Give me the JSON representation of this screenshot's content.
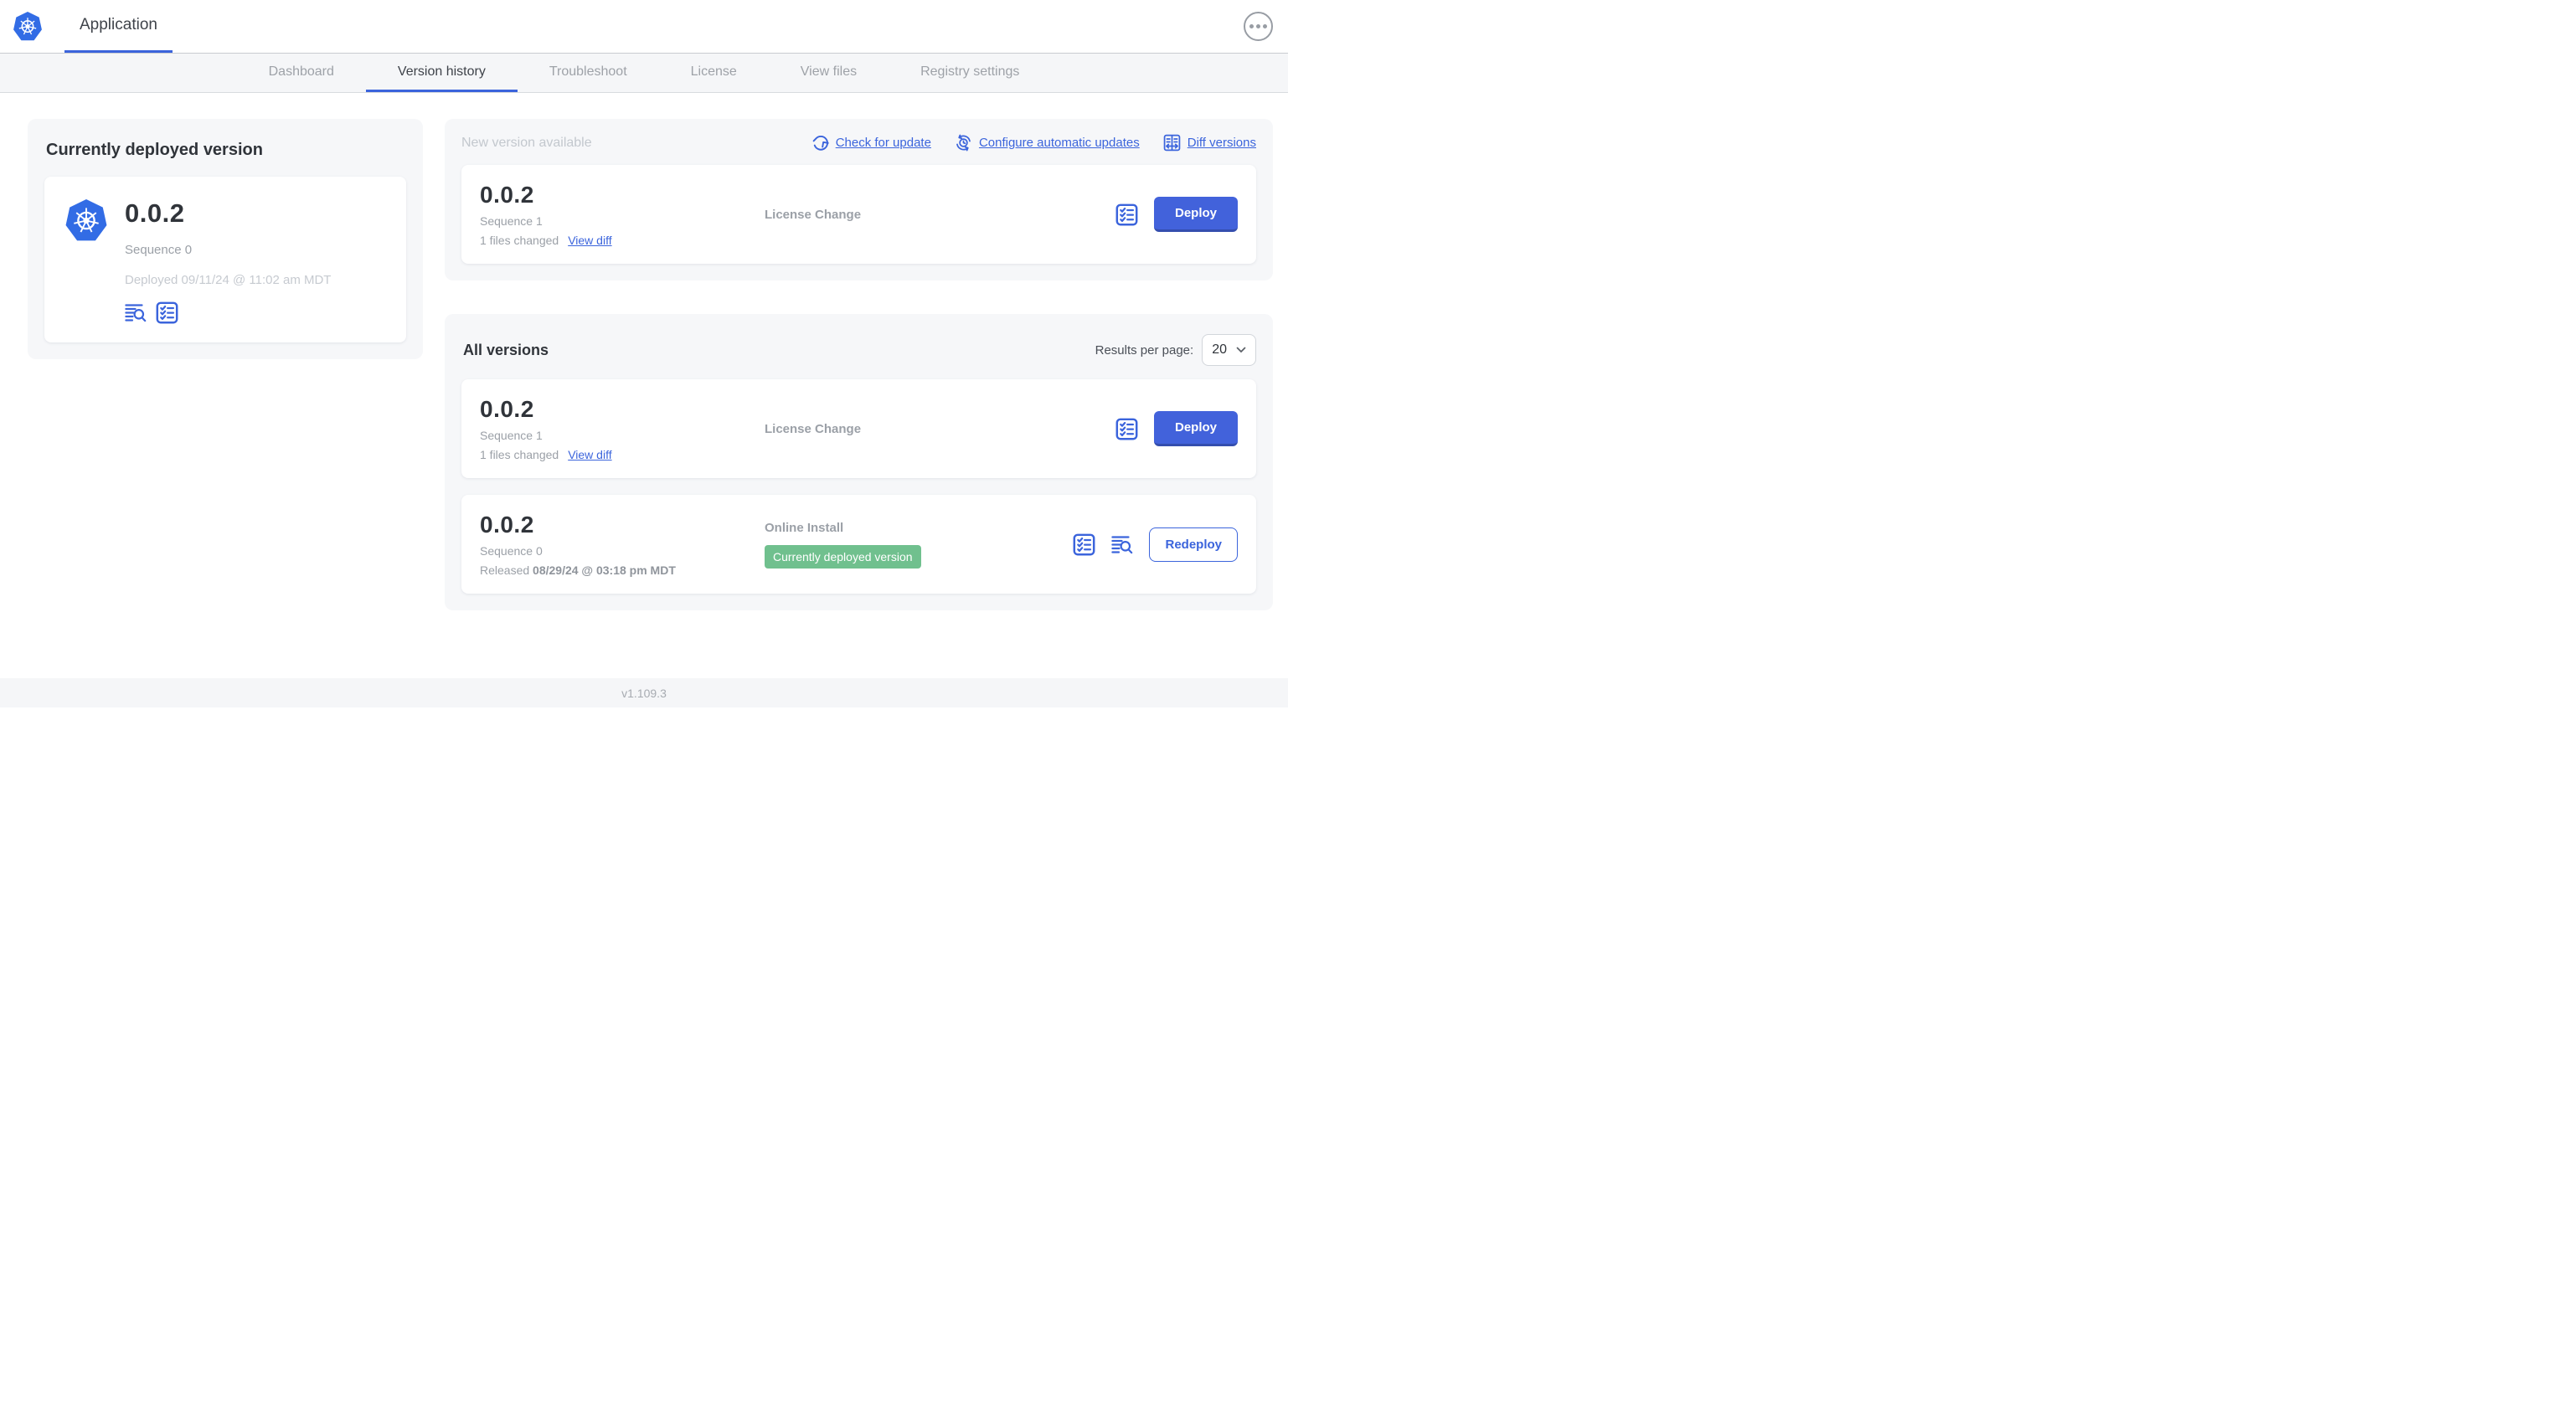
{
  "colors": {
    "accent_blue": "#3b64dc",
    "button_blue": "#4262db",
    "kubernetes_blue": "#326ce5",
    "badge_green": "#70c08e",
    "panel_gray": "#f6f7f9"
  },
  "header": {
    "app_tab_label": "Application"
  },
  "nav_tabs": [
    {
      "label": "Dashboard",
      "active": false
    },
    {
      "label": "Version history",
      "active": true
    },
    {
      "label": "Troubleshoot",
      "active": false
    },
    {
      "label": "License",
      "active": false
    },
    {
      "label": "View files",
      "active": false
    },
    {
      "label": "Registry settings",
      "active": false
    }
  ],
  "current_version": {
    "title": "Currently deployed version",
    "version": "0.0.2",
    "sequence": "Sequence 0",
    "deployed": "Deployed 09/11/24 @ 11:02 am MDT"
  },
  "new_version": {
    "title": "New version available",
    "check_for_update": "Check for update",
    "configure_automatic_updates": "Configure automatic updates",
    "diff_versions": "Diff versions",
    "row": {
      "version": "0.0.2",
      "sequence": "Sequence 1",
      "files_changed": "1 files changed",
      "view_diff": "View diff",
      "source": "License Change",
      "action": "Deploy"
    }
  },
  "all_versions": {
    "title": "All versions",
    "results_per_page_label": "Results per page:",
    "results_per_page_value": "20",
    "rows": [
      {
        "version": "0.0.2",
        "sequence": "Sequence 1",
        "files_changed": "1 files changed",
        "view_diff": "View diff",
        "source": "License Change",
        "action": "Deploy"
      },
      {
        "version": "0.0.2",
        "sequence": "Sequence 0",
        "released_label": "Released",
        "released_date": "08/29/24 @ 03:18 pm MDT",
        "source": "Online Install",
        "badge": "Currently deployed version",
        "action": "Redeploy"
      }
    ]
  },
  "footer": {
    "version": "v1.109.3"
  }
}
